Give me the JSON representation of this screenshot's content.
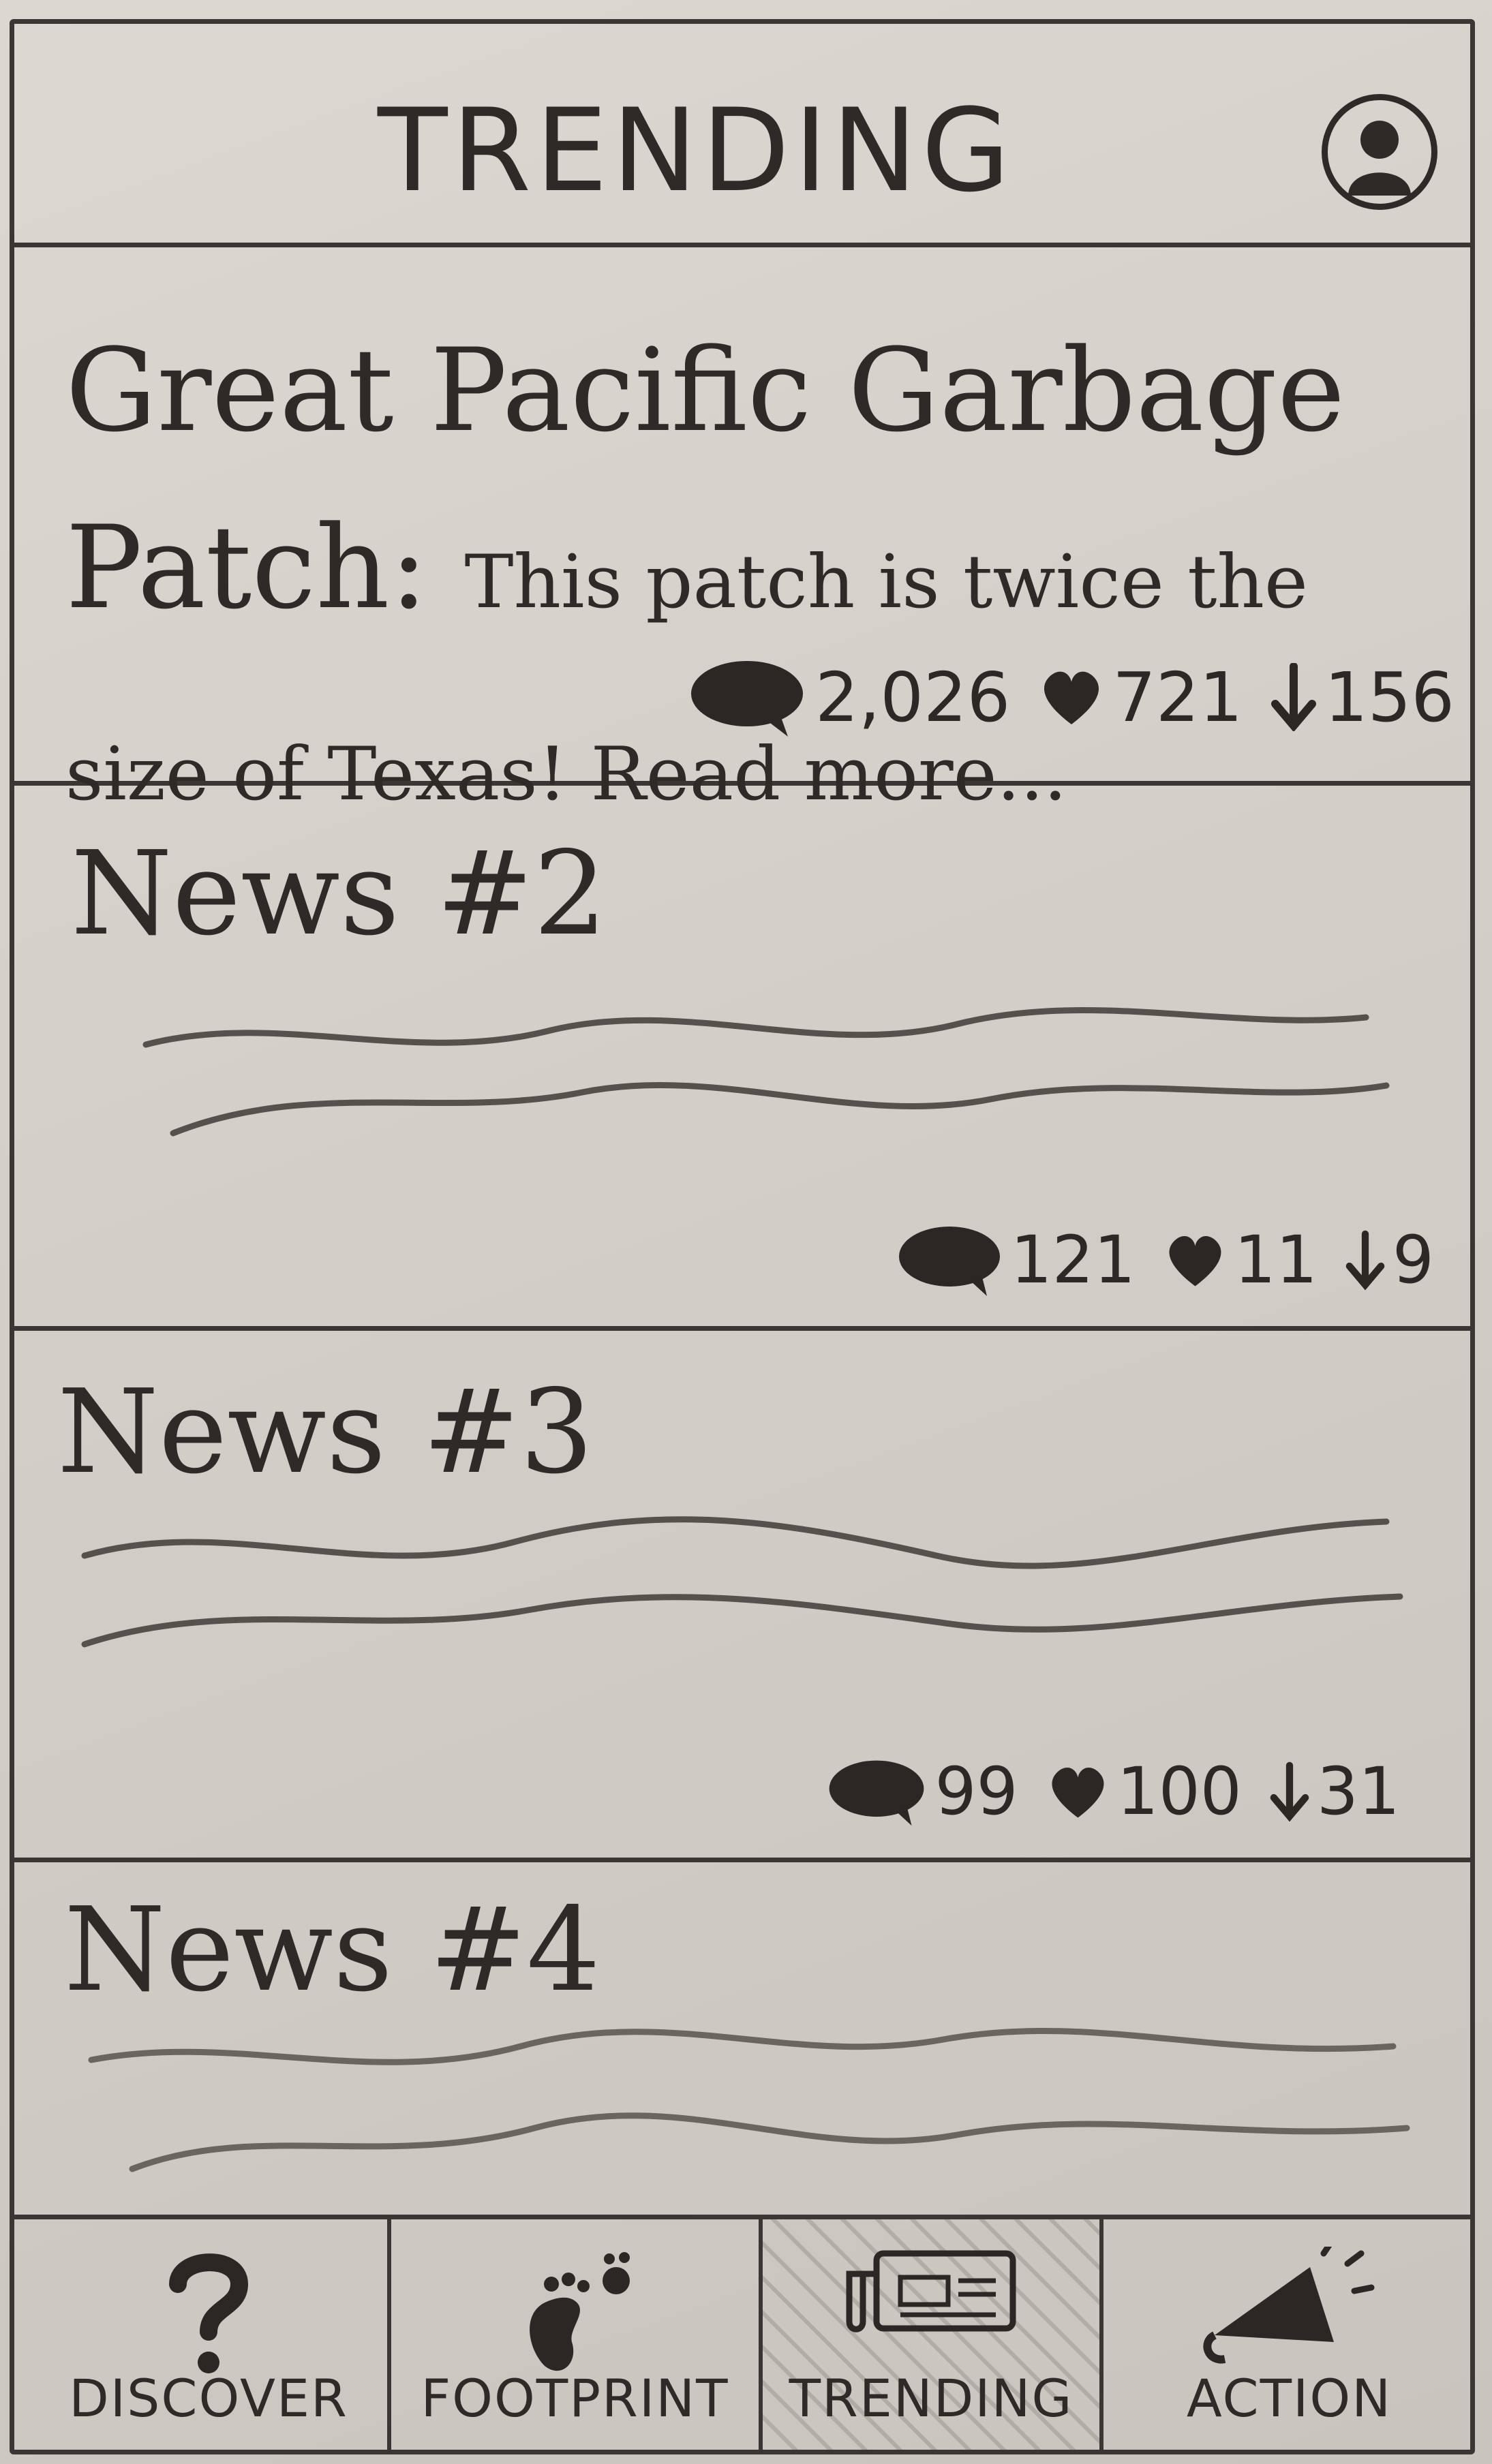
{
  "header": {
    "title": "TRENDING",
    "profile_icon": "person-avatar-icon"
  },
  "articles": [
    {
      "title": "Great Pacific Garbage Patch:",
      "summary": "This patch is twice the size of Texas! Read more...",
      "comments": "2,026",
      "likes": "721",
      "downvotes": "156"
    },
    {
      "title": "News #2",
      "comments": "121",
      "likes": "11",
      "downvotes": "9"
    },
    {
      "title": "News #3",
      "comments": "99",
      "likes": "100",
      "downvotes": "31"
    },
    {
      "title": "News #4"
    }
  ],
  "nav": {
    "items": [
      {
        "label": "DISCOVER",
        "icon": "question-mark-icon"
      },
      {
        "label": "FOOTPRINT",
        "icon": "footprint-icon"
      },
      {
        "label": "TRENDING",
        "icon": "newspaper-icon"
      },
      {
        "label": "ACTION",
        "icon": "megaphone-icon"
      }
    ],
    "active_index": 2
  },
  "colors": {
    "ink": "#2d2a27",
    "paper": "#d6d1cb"
  }
}
